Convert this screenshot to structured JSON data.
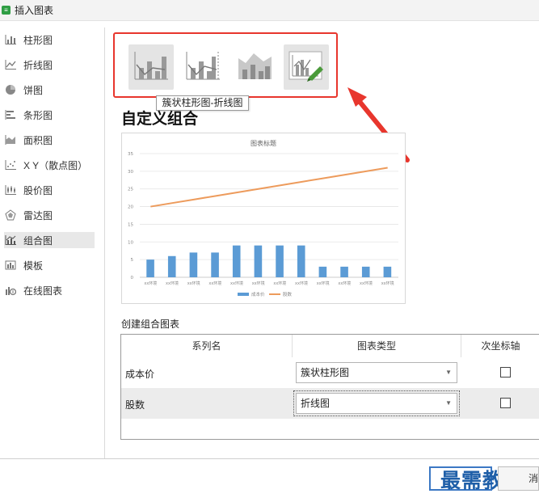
{
  "window": {
    "title": "插入图表"
  },
  "sidebar": {
    "items": [
      {
        "label": "柱形图",
        "icon": "column-chart-icon"
      },
      {
        "label": "折线图",
        "icon": "line-chart-icon"
      },
      {
        "label": "饼图",
        "icon": "pie-chart-icon"
      },
      {
        "label": "条形图",
        "icon": "bar-chart-icon"
      },
      {
        "label": "面积图",
        "icon": "area-chart-icon"
      },
      {
        "label": "X Y（散点图）",
        "icon": "scatter-chart-icon"
      },
      {
        "label": "股价图",
        "icon": "stock-chart-icon"
      },
      {
        "label": "雷达图",
        "icon": "radar-chart-icon"
      },
      {
        "label": "组合图",
        "icon": "combo-chart-icon",
        "active": true
      },
      {
        "label": "模板",
        "icon": "template-icon"
      },
      {
        "label": "在线图表",
        "icon": "online-chart-icon"
      }
    ]
  },
  "thumbnails": {
    "tooltip": "簇状柱形图-折线图",
    "items": [
      {
        "icon": "clustered-column-line-icon"
      },
      {
        "icon": "column-line-secondary-axis-icon"
      },
      {
        "icon": "stacked-area-column-icon"
      },
      {
        "icon": "custom-combo-icon",
        "selected": true
      }
    ]
  },
  "section_title": "自定义组合",
  "chart_data": {
    "type": "bar",
    "title": "图表标题",
    "categories": [
      "xx环境",
      "xx环境",
      "xx环境",
      "xx环境",
      "xx环境",
      "xx环境",
      "xx环境",
      "xx环境",
      "xx环境",
      "xx环境",
      "xx环境",
      "xx环境"
    ],
    "series": [
      {
        "name": "成本价",
        "type": "bar",
        "color": "#5b9bd5",
        "values": [
          5,
          6,
          7,
          7,
          9,
          9,
          9,
          9,
          3,
          3,
          3,
          3
        ]
      },
      {
        "name": "股数",
        "type": "line",
        "color": "#ed9b5c",
        "values": [
          20,
          21,
          22,
          23,
          24,
          25,
          26,
          27,
          28,
          29,
          30,
          31
        ]
      }
    ],
    "yticks": [
      "0",
      "5",
      "10",
      "15",
      "20",
      "25",
      "30",
      "35"
    ],
    "ylim": [
      0,
      35
    ],
    "grid": true,
    "legend": "bottom"
  },
  "combo": {
    "label": "创建组合图表",
    "headers": {
      "series": "系列名",
      "type": "图表类型",
      "secondary": "次坐标轴"
    },
    "rows": [
      {
        "name": "成本价",
        "type": "簇状柱形图",
        "secondary": false
      },
      {
        "name": "股数",
        "type": "折线图",
        "secondary": false
      }
    ]
  },
  "footer": {
    "watermark": "最需教育",
    "cancel_label": "消"
  },
  "colors": {
    "highlight": "#e8362d",
    "bar": "#5b9bd5",
    "line": "#ed9b5c"
  }
}
